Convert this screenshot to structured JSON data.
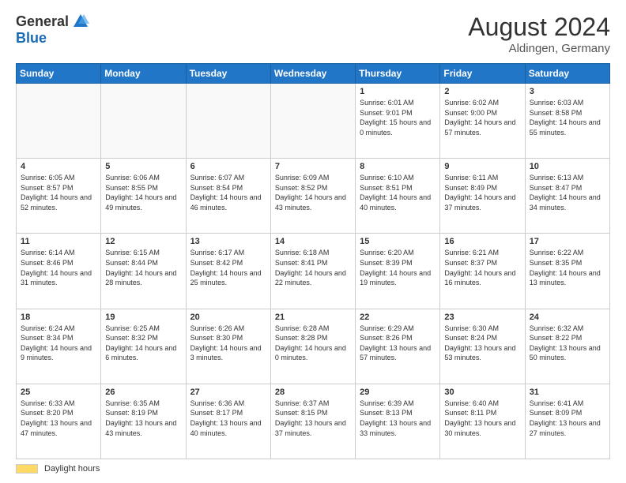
{
  "header": {
    "logo_general": "General",
    "logo_blue": "Blue",
    "month_year": "August 2024",
    "location": "Aldingen, Germany"
  },
  "weekdays": [
    "Sunday",
    "Monday",
    "Tuesday",
    "Wednesday",
    "Thursday",
    "Friday",
    "Saturday"
  ],
  "footer": {
    "legend_label": "Daylight hours"
  },
  "weeks": [
    [
      {
        "day": "",
        "info": ""
      },
      {
        "day": "",
        "info": ""
      },
      {
        "day": "",
        "info": ""
      },
      {
        "day": "",
        "info": ""
      },
      {
        "day": "1",
        "info": "Sunrise: 6:01 AM\nSunset: 9:01 PM\nDaylight: 15 hours\nand 0 minutes."
      },
      {
        "day": "2",
        "info": "Sunrise: 6:02 AM\nSunset: 9:00 PM\nDaylight: 14 hours\nand 57 minutes."
      },
      {
        "day": "3",
        "info": "Sunrise: 6:03 AM\nSunset: 8:58 PM\nDaylight: 14 hours\nand 55 minutes."
      }
    ],
    [
      {
        "day": "4",
        "info": "Sunrise: 6:05 AM\nSunset: 8:57 PM\nDaylight: 14 hours\nand 52 minutes."
      },
      {
        "day": "5",
        "info": "Sunrise: 6:06 AM\nSunset: 8:55 PM\nDaylight: 14 hours\nand 49 minutes."
      },
      {
        "day": "6",
        "info": "Sunrise: 6:07 AM\nSunset: 8:54 PM\nDaylight: 14 hours\nand 46 minutes."
      },
      {
        "day": "7",
        "info": "Sunrise: 6:09 AM\nSunset: 8:52 PM\nDaylight: 14 hours\nand 43 minutes."
      },
      {
        "day": "8",
        "info": "Sunrise: 6:10 AM\nSunset: 8:51 PM\nDaylight: 14 hours\nand 40 minutes."
      },
      {
        "day": "9",
        "info": "Sunrise: 6:11 AM\nSunset: 8:49 PM\nDaylight: 14 hours\nand 37 minutes."
      },
      {
        "day": "10",
        "info": "Sunrise: 6:13 AM\nSunset: 8:47 PM\nDaylight: 14 hours\nand 34 minutes."
      }
    ],
    [
      {
        "day": "11",
        "info": "Sunrise: 6:14 AM\nSunset: 8:46 PM\nDaylight: 14 hours\nand 31 minutes."
      },
      {
        "day": "12",
        "info": "Sunrise: 6:15 AM\nSunset: 8:44 PM\nDaylight: 14 hours\nand 28 minutes."
      },
      {
        "day": "13",
        "info": "Sunrise: 6:17 AM\nSunset: 8:42 PM\nDaylight: 14 hours\nand 25 minutes."
      },
      {
        "day": "14",
        "info": "Sunrise: 6:18 AM\nSunset: 8:41 PM\nDaylight: 14 hours\nand 22 minutes."
      },
      {
        "day": "15",
        "info": "Sunrise: 6:20 AM\nSunset: 8:39 PM\nDaylight: 14 hours\nand 19 minutes."
      },
      {
        "day": "16",
        "info": "Sunrise: 6:21 AM\nSunset: 8:37 PM\nDaylight: 14 hours\nand 16 minutes."
      },
      {
        "day": "17",
        "info": "Sunrise: 6:22 AM\nSunset: 8:35 PM\nDaylight: 14 hours\nand 13 minutes."
      }
    ],
    [
      {
        "day": "18",
        "info": "Sunrise: 6:24 AM\nSunset: 8:34 PM\nDaylight: 14 hours\nand 9 minutes."
      },
      {
        "day": "19",
        "info": "Sunrise: 6:25 AM\nSunset: 8:32 PM\nDaylight: 14 hours\nand 6 minutes."
      },
      {
        "day": "20",
        "info": "Sunrise: 6:26 AM\nSunset: 8:30 PM\nDaylight: 14 hours\nand 3 minutes."
      },
      {
        "day": "21",
        "info": "Sunrise: 6:28 AM\nSunset: 8:28 PM\nDaylight: 14 hours\nand 0 minutes."
      },
      {
        "day": "22",
        "info": "Sunrise: 6:29 AM\nSunset: 8:26 PM\nDaylight: 13 hours\nand 57 minutes."
      },
      {
        "day": "23",
        "info": "Sunrise: 6:30 AM\nSunset: 8:24 PM\nDaylight: 13 hours\nand 53 minutes."
      },
      {
        "day": "24",
        "info": "Sunrise: 6:32 AM\nSunset: 8:22 PM\nDaylight: 13 hours\nand 50 minutes."
      }
    ],
    [
      {
        "day": "25",
        "info": "Sunrise: 6:33 AM\nSunset: 8:20 PM\nDaylight: 13 hours\nand 47 minutes."
      },
      {
        "day": "26",
        "info": "Sunrise: 6:35 AM\nSunset: 8:19 PM\nDaylight: 13 hours\nand 43 minutes."
      },
      {
        "day": "27",
        "info": "Sunrise: 6:36 AM\nSunset: 8:17 PM\nDaylight: 13 hours\nand 40 minutes."
      },
      {
        "day": "28",
        "info": "Sunrise: 6:37 AM\nSunset: 8:15 PM\nDaylight: 13 hours\nand 37 minutes."
      },
      {
        "day": "29",
        "info": "Sunrise: 6:39 AM\nSunset: 8:13 PM\nDaylight: 13 hours\nand 33 minutes."
      },
      {
        "day": "30",
        "info": "Sunrise: 6:40 AM\nSunset: 8:11 PM\nDaylight: 13 hours\nand 30 minutes."
      },
      {
        "day": "31",
        "info": "Sunrise: 6:41 AM\nSunset: 8:09 PM\nDaylight: 13 hours\nand 27 minutes."
      }
    ]
  ]
}
